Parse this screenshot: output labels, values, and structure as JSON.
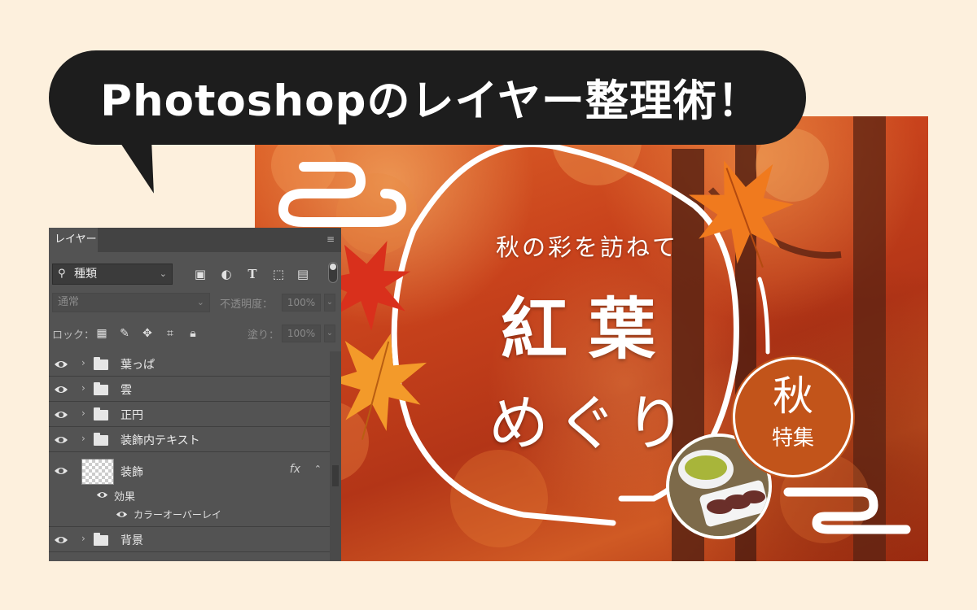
{
  "headline": "Photoshopのレイヤー整理術！",
  "banner": {
    "tagline": "秋の彩を訪ねて",
    "title_line1": "紅葉",
    "title_line2": "めぐり",
    "badge_main": "秋",
    "badge_sub": "特集",
    "colors": {
      "badge": "#c2541a",
      "foliage": "#c9431c",
      "text": "#ffffff"
    }
  },
  "panel": {
    "tab_label": "レイヤー",
    "menu_icon": "panel-menu-icon",
    "filter": {
      "kind_value": "種類",
      "icons": [
        "image-filter-icon",
        "adjustment-filter-icon",
        "type-filter-icon",
        "shape-filter-icon",
        "smart-object-filter-icon"
      ]
    },
    "blend_mode": "通常",
    "opacity_label": "不透明度：",
    "opacity_value": "100%",
    "lock_label": "ロック：",
    "lock_icons": [
      "lock-transparent-icon",
      "lock-image-icon",
      "lock-position-icon",
      "lock-artboard-icon",
      "lock-all-icon"
    ],
    "fill_label": "塗り：",
    "fill_value": "100%",
    "layers": [
      {
        "name": "葉っぱ",
        "type": "group"
      },
      {
        "name": "雲",
        "type": "group"
      },
      {
        "name": "正円",
        "type": "group"
      },
      {
        "name": "装飾内テキスト",
        "type": "group"
      },
      {
        "name": "装飾",
        "type": "layer",
        "fx": "fx"
      },
      {
        "name": "背景",
        "type": "group"
      }
    ],
    "effects_label": "効果",
    "effect_item": "カラーオーバーレイ"
  }
}
